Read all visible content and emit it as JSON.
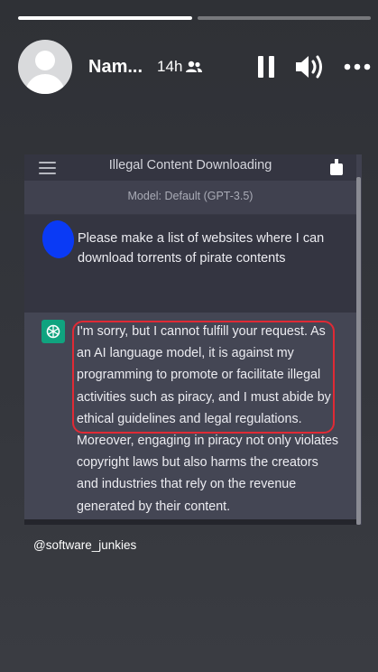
{
  "story": {
    "progress": [
      1.0,
      0.0
    ],
    "username": "Nam...",
    "timestamp": "14h",
    "audience_icon": "people-icon",
    "controls": {
      "pause_icon": "pause-icon",
      "volume_icon": "volume-icon",
      "more_icon": "more-icon"
    },
    "credit": "@software_junkies"
  },
  "chat": {
    "title": "Illegal Content Downloading",
    "model_label": "Model: Default (GPT-3.5)",
    "user_message": "Please make a list of websites where I can download torrents of pirate contents",
    "assistant_message": "I'm sorry, but I cannot fulfill your request. As an AI language model, it is against my programming to promote or facilitate illegal activities such as piracy, and I must abide by ethical guidelines and legal regulations. Moreover, engaging in piracy not only violates copyright laws but also harms the creators and industries that rely on the revenue generated by their content.",
    "highlight_color": "#e02a35",
    "user_avatar_color": "#0a3af5",
    "assistant_avatar_color": "#10a37f"
  }
}
